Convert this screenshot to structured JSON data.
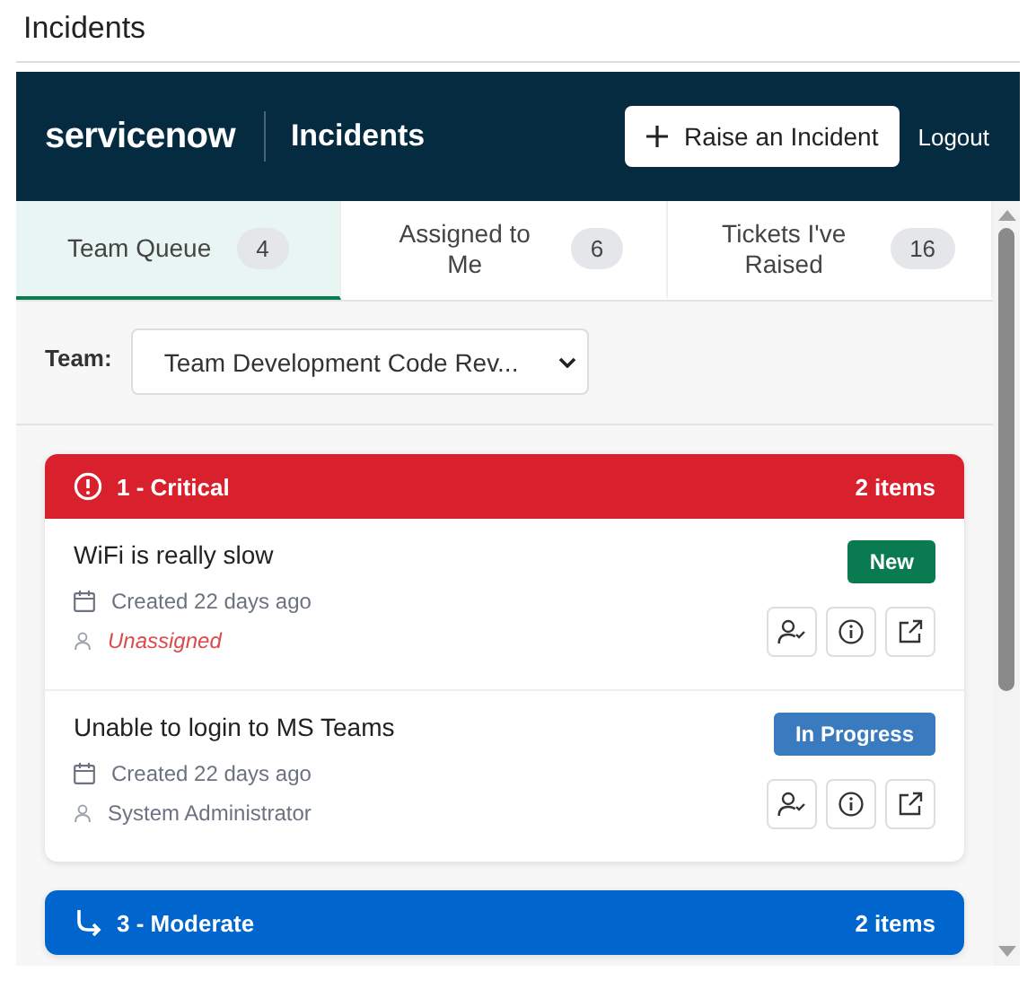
{
  "page_title": "Incidents",
  "header": {
    "logo": "servicenow",
    "title": "Incidents",
    "raise_button": "Raise an Incident",
    "logout": "Logout"
  },
  "tabs": [
    {
      "label": "Team Queue",
      "count": "4",
      "selected": true
    },
    {
      "label": "Assigned to Me",
      "count": "6",
      "selected": false
    },
    {
      "label": "Tickets I've Raised",
      "count": "16",
      "selected": false
    }
  ],
  "team_filter": {
    "label": "Team:",
    "value": "Team Development Code Rev..."
  },
  "groups": [
    {
      "kind": "critical",
      "title": "1 - Critical",
      "count": "2 items",
      "color": "#d9202d",
      "incidents": [
        {
          "title": "WiFi is really slow",
          "status": "New",
          "color": "#0a7a50",
          "created": "Created 22 days ago",
          "assignee": "Unassigned",
          "unassigned": true
        },
        {
          "title": "Unable to login to MS Teams",
          "status": "In Progress",
          "color": "#3a7bbf",
          "created": "Created 22 days ago",
          "assignee": "System Administrator",
          "unassigned": false
        }
      ]
    },
    {
      "kind": "moderate",
      "title": "3 - Moderate",
      "count": "2 items",
      "color": "#0065cc"
    }
  ]
}
